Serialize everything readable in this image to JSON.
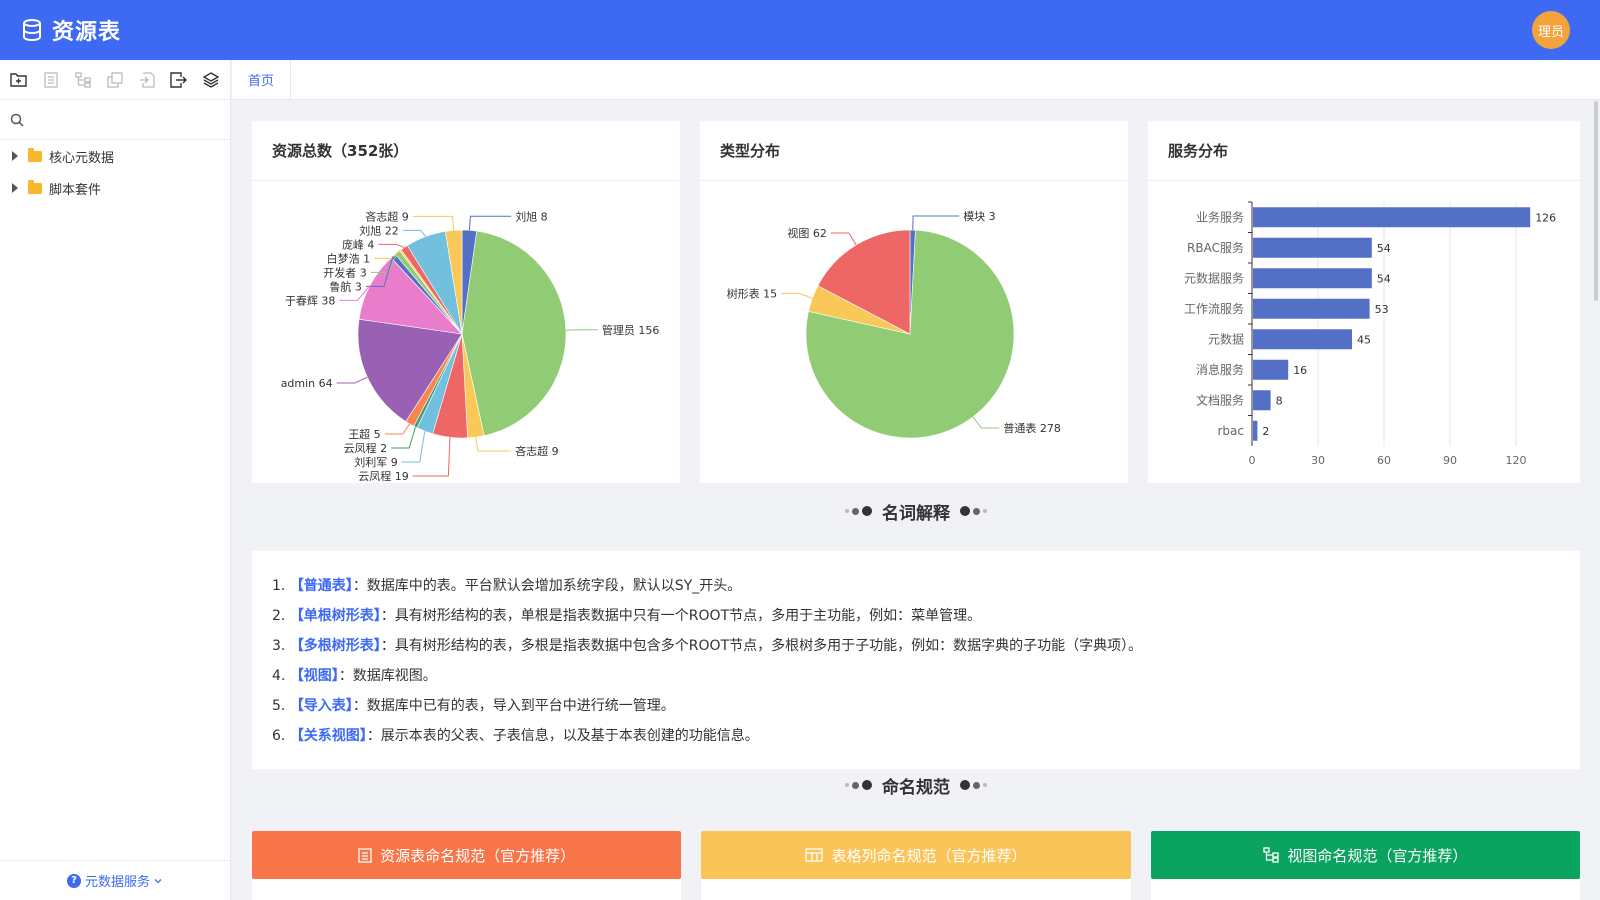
{
  "header": {
    "title": "资源表",
    "avatar": "理员"
  },
  "sidebar": {
    "search_placeholder": "",
    "tree": [
      {
        "label": "核心元数据"
      },
      {
        "label": "脚本套件"
      }
    ],
    "footer": "元数据服务"
  },
  "tabs": [
    {
      "label": "首页"
    }
  ],
  "colors": {
    "primary": "#3e6af3",
    "orange": "#f8754a",
    "yellow": "#fac458",
    "green": "#0ba360"
  },
  "cards": {
    "total": {
      "title": "资源总数（352张）"
    },
    "type": {
      "title": "类型分布"
    },
    "service": {
      "title": "服务分布"
    }
  },
  "chart_data": [
    {
      "type": "pie",
      "title": "资源总数（352张）",
      "slices": [
        {
          "name": "刘旭",
          "value": 8,
          "color": "#5470c6"
        },
        {
          "name": "管理员",
          "value": 156,
          "color": "#91cc75"
        },
        {
          "name": "吝志超",
          "value": 9,
          "color": "#fac858"
        },
        {
          "name": "云凤程",
          "value": 19,
          "color": "#ee6666"
        },
        {
          "name": "刘利军",
          "value": 9,
          "color": "#73c0de"
        },
        {
          "name": "云凤程",
          "value": 2,
          "color": "#3ba272"
        },
        {
          "name": "王超",
          "value": 5,
          "color": "#fc8452"
        },
        {
          "name": "admin",
          "value": 64,
          "color": "#9a60b4"
        },
        {
          "name": "于春辉",
          "value": 38,
          "color": "#ea7ccc"
        },
        {
          "name": "鲁航",
          "value": 3,
          "color": "#5470c6"
        },
        {
          "name": "开发者",
          "value": 3,
          "color": "#91cc75"
        },
        {
          "name": "白梦浩",
          "value": 1,
          "color": "#fac858"
        },
        {
          "name": "庞峰",
          "value": 4,
          "color": "#ee6666"
        },
        {
          "name": "刘旭",
          "value": 22,
          "color": "#73c0de"
        },
        {
          "name": "吝志超",
          "value": 9,
          "color": "#fac858"
        }
      ]
    },
    {
      "type": "pie",
      "title": "类型分布",
      "slices": [
        {
          "name": "模块",
          "value": 3,
          "color": "#5470c6"
        },
        {
          "name": "普通表",
          "value": 278,
          "color": "#91cc75"
        },
        {
          "name": "树形表",
          "value": 15,
          "color": "#fac858"
        },
        {
          "name": "视图",
          "value": 62,
          "color": "#ee6666"
        }
      ]
    },
    {
      "type": "bar",
      "orientation": "horizontal",
      "title": "服务分布",
      "categories": [
        "业务服务",
        "RBAC服务",
        "元数据服务",
        "工作流服务",
        "元数据",
        "消息服务",
        "文档服务",
        "rbac"
      ],
      "values": [
        126,
        54,
        54,
        53,
        45,
        16,
        8,
        2
      ],
      "xlim": [
        0,
        130
      ],
      "ticks": [
        0,
        30,
        60,
        90,
        120
      ],
      "color": "#5470c6"
    }
  ],
  "sections": {
    "glossary": "名词解释",
    "naming": "命名规范"
  },
  "glossary": [
    {
      "num": "1.",
      "term": "【普通表】",
      "desc": "：数据库中的表。平台默认会增加系统字段，默认以SY_开头。"
    },
    {
      "num": "2.",
      "term": "【单根树形表】",
      "desc": "：具有树形结构的表，单根是指表数据中只有一个ROOT节点，多用于主功能，例如：菜单管理。"
    },
    {
      "num": "3.",
      "term": "【多根树形表】",
      "desc": "：具有树形结构的表，多根是指表数据中包含多个ROOT节点，多根树多用于子功能，例如：数据字典的子功能（字典项）。"
    },
    {
      "num": "4.",
      "term": "【视图】",
      "desc": "：数据库视图。"
    },
    {
      "num": "5.",
      "term": "【导入表】",
      "desc": "：数据库中已有的表，导入到平台中进行统一管理。"
    },
    {
      "num": "6.",
      "term": "【关系视图】",
      "desc": "：展示本表的父表、子表信息，以及基于本表创建的功能信息。"
    }
  ],
  "naming_buttons": [
    {
      "label": "资源表命名规范（官方推荐）"
    },
    {
      "label": "表格列命名规范（官方推荐）"
    },
    {
      "label": "视图命名规范（官方推荐）"
    }
  ]
}
